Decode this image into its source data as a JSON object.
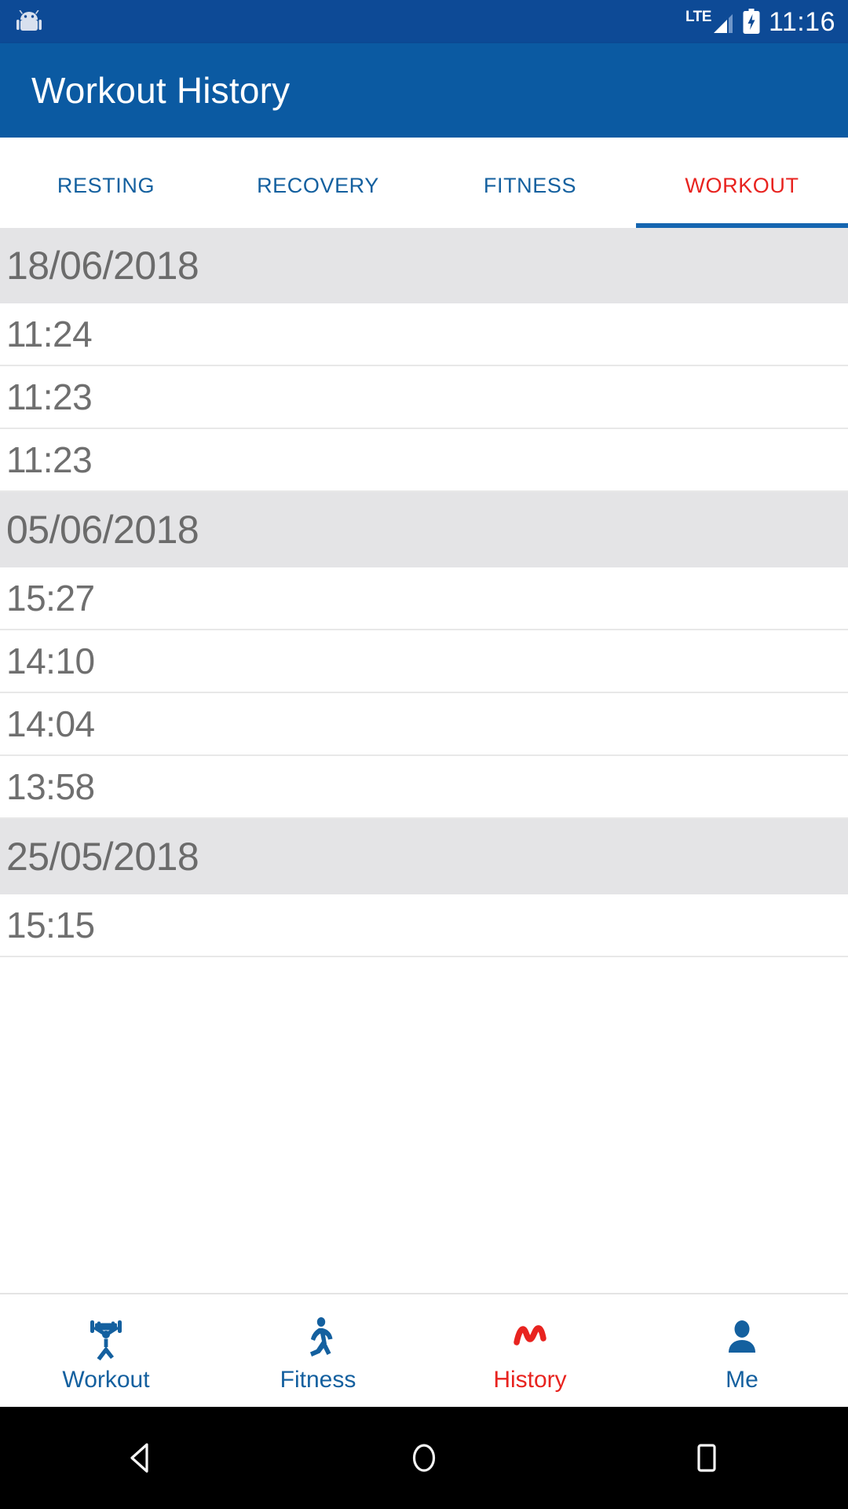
{
  "status_bar": {
    "notification_icon": "android-robot-icon",
    "network_type": "LTE",
    "signal_icon": "signal-bars-icon",
    "battery_icon": "battery-charging-icon",
    "time": "11:16",
    "background_color": "#0d4a96"
  },
  "app_bar": {
    "title": "Workout History",
    "background_color": "#0b5aa2",
    "text_color": "#ffffff"
  },
  "tabs": {
    "active_index": 3,
    "inactive_color": "#14609f",
    "active_color": "#e8231f",
    "indicator_color": "#1565b0",
    "items": [
      {
        "label": "RESTING"
      },
      {
        "label": "RECOVERY"
      },
      {
        "label": "FITNESS"
      },
      {
        "label": "WORKOUT"
      }
    ]
  },
  "list": {
    "header_background": "#e4e4e6",
    "header_text_color": "#6b6b6b",
    "row_text_color": "#6f6f6f",
    "divider_color": "#e8e8e8",
    "groups": [
      {
        "date": "18/06/2018",
        "entries": [
          {
            "time": "11:24"
          },
          {
            "time": "11:23"
          },
          {
            "time": "11:23"
          }
        ]
      },
      {
        "date": "05/06/2018",
        "entries": [
          {
            "time": "15:27"
          },
          {
            "time": "14:10"
          },
          {
            "time": "14:04"
          },
          {
            "time": "13:58"
          }
        ]
      },
      {
        "date": "25/05/2018",
        "entries": [
          {
            "time": "15:15"
          }
        ]
      }
    ]
  },
  "bottom_nav": {
    "active_index": 2,
    "inactive_color": "#14609f",
    "active_color": "#e8231f",
    "items": [
      {
        "label": "Workout",
        "icon": "weightlifter-icon"
      },
      {
        "label": "Fitness",
        "icon": "running-person-icon"
      },
      {
        "label": "History",
        "icon": "zigzag-chart-icon"
      },
      {
        "label": "Me",
        "icon": "person-avatar-icon"
      }
    ]
  },
  "system_nav": {
    "background_color": "#000000",
    "buttons": [
      {
        "icon": "back-triangle-icon"
      },
      {
        "icon": "home-circle-icon"
      },
      {
        "icon": "recents-square-icon"
      }
    ]
  }
}
